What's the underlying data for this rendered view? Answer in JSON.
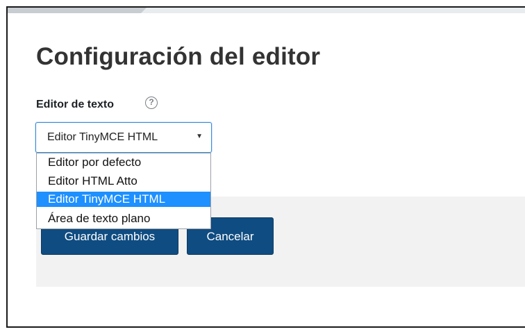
{
  "page": {
    "title": "Configuración del editor"
  },
  "form": {
    "field_label": "Editor de texto",
    "help_icon_glyph": "?",
    "select": {
      "selected_value": "Editor TinyMCE HTML",
      "arrow_glyph": "▼",
      "options": [
        "Editor por defecto",
        "Editor HTML Atto",
        "Editor TinyMCE HTML",
        "Área de texto plano"
      ],
      "highlighted_option": "Editor TinyMCE HTML"
    },
    "buttons": {
      "save_label": "Guardar cambios",
      "cancel_label": "Cancelar"
    }
  },
  "colors": {
    "button_bg": "#0f4c81",
    "selected_option_bg": "#1e90ff",
    "select_border": "#3c8dd8",
    "footer_panel_bg": "#f2f2f2"
  }
}
